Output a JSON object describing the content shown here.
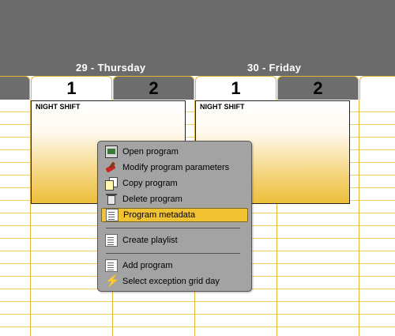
{
  "days": [
    {
      "label": "29 - Thursday",
      "tabs": [
        "1",
        "2"
      ],
      "block_title": "NIGHT SHIFT"
    },
    {
      "label": "30 - Friday",
      "tabs": [
        "1",
        "2"
      ],
      "block_title": "NIGHT SHIFT"
    }
  ],
  "context_menu": {
    "items": [
      {
        "label": "Open program",
        "icon": "open-program-icon"
      },
      {
        "label": "Modify program parameters",
        "icon": "modify-parameters-icon"
      },
      {
        "label": "Copy program",
        "icon": "copy-icon"
      },
      {
        "label": "Delete program",
        "icon": "trash-icon"
      },
      {
        "label": "Program metadata",
        "icon": "metadata-icon",
        "highlighted": true
      },
      {
        "label": "Create playlist",
        "icon": "playlist-icon"
      },
      {
        "label": "Add program",
        "icon": "add-program-icon"
      },
      {
        "label": "Select exception grid day",
        "icon": "lightning-icon"
      }
    ]
  },
  "colors": {
    "header_bg": "#6b6b6b",
    "grid_line": "#f0cf6a",
    "highlight": "#f1c232",
    "menu_bg": "#a3a3a3"
  }
}
